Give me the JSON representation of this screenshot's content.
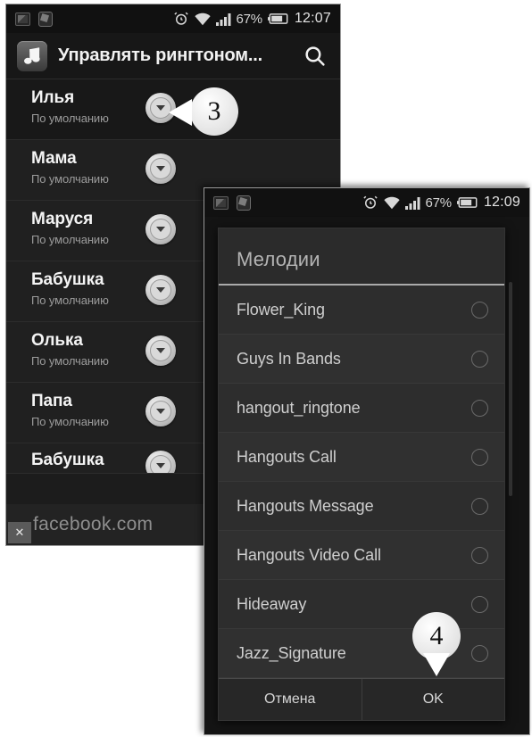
{
  "phone1": {
    "status_bar": {
      "icons": [
        "message-icon",
        "screenshot-icon",
        "alarm-icon",
        "wifi-icon",
        "signal-icon",
        "battery-icon"
      ],
      "battery_percent": "67%",
      "time": "12:07"
    },
    "action_bar": {
      "app_icon": "music-note-icon",
      "title": "Управлять рингтоном...",
      "search_icon": "search-icon"
    },
    "contacts": [
      {
        "name": "Илья",
        "subtitle": "По умолчанию",
        "highlighted": true
      },
      {
        "name": "Мама",
        "subtitle": "По умолчанию",
        "highlighted": false
      },
      {
        "name": "Маруся",
        "subtitle": "По умолчанию",
        "highlighted": false
      },
      {
        "name": "Бабушка",
        "subtitle": "По умолчанию",
        "highlighted": false
      },
      {
        "name": "Олька",
        "subtitle": "По умолчанию",
        "highlighted": false
      },
      {
        "name": "Папа",
        "subtitle": "По умолчанию",
        "highlighted": false
      },
      {
        "name": "Бабушка",
        "subtitle": "",
        "highlighted": false
      }
    ],
    "watermark": {
      "text": "facebook.com",
      "close_label": "✕"
    }
  },
  "phone2": {
    "status_bar": {
      "battery_percent": "67%",
      "time": "12:09"
    },
    "dialog": {
      "title": "Мелодии",
      "tones": [
        {
          "name": "Flower_King",
          "selected": false
        },
        {
          "name": "Guys In Bands",
          "selected": false
        },
        {
          "name": "hangout_ringtone",
          "selected": false
        },
        {
          "name": "Hangouts Call",
          "selected": false
        },
        {
          "name": "Hangouts Message",
          "selected": false
        },
        {
          "name": "Hangouts Video Call",
          "selected": false
        },
        {
          "name": "Hideaway",
          "selected": false
        },
        {
          "name": "Jazz_Signature",
          "selected": false
        }
      ],
      "cancel_label": "Отмена",
      "ok_label": "OK"
    }
  },
  "callouts": [
    {
      "id": "3",
      "label": "3",
      "direction": "left"
    },
    {
      "id": "4",
      "label": "4",
      "direction": "down"
    }
  ],
  "colors": {
    "phone_bg": "#1c1c1c",
    "status_bar_bg": "#111111",
    "row_bg": "#202020",
    "dialog_bg": "#2b2b2b",
    "text_primary": "#f4f4f4",
    "text_secondary": "#9c9c9c",
    "callout_bg": "#ffffff"
  }
}
